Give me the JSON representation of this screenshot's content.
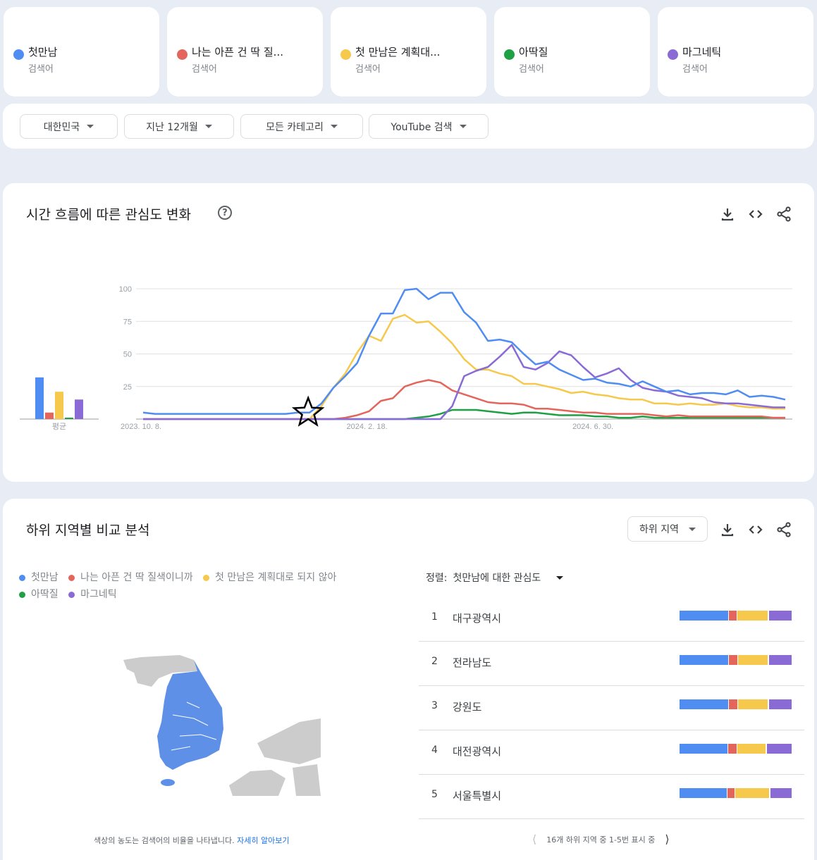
{
  "terms": [
    {
      "name": "첫만남",
      "sub": "검색어",
      "color": "#4f8df2"
    },
    {
      "name": "나는 아픈 건 딱 질...",
      "sub": "검색어",
      "color": "#e4655c"
    },
    {
      "name": "첫 만남은 계획대...",
      "sub": "검색어",
      "color": "#f6c94c"
    },
    {
      "name": "아딱질",
      "sub": "검색어",
      "color": "#1fa045"
    },
    {
      "name": "마그네틱",
      "sub": "검색어",
      "color": "#8a6bd6"
    }
  ],
  "filters": [
    {
      "label": "대한민국"
    },
    {
      "label": "지난 12개월"
    },
    {
      "label": "모든 카테고리"
    },
    {
      "label": "YouTube 검색"
    }
  ],
  "timeline": {
    "title": "시간 흐름에 따른 관심도 변화",
    "help": "?",
    "avg_label": "평균"
  },
  "icons": {
    "download": "download-icon",
    "embed": "embed-code-icon",
    "share": "share-icon"
  },
  "chart_data": {
    "type": "line",
    "title": "시간 흐름에 따른 관심도 변화",
    "ylim": [
      0,
      100
    ],
    "yticks": [
      "100",
      "75",
      "50",
      "25"
    ],
    "xtick_labels": [
      "2023. 10. 8.",
      "2024. 2. 18.",
      "2024. 6. 30."
    ],
    "xtick_index": [
      0,
      19,
      38
    ],
    "annotation": {
      "type": "star",
      "index": 14
    },
    "grid": true,
    "averages": {
      "label": "평균",
      "values": [
        32,
        5,
        21,
        1,
        15
      ]
    },
    "series": [
      {
        "name": "첫만남",
        "color": "#4f8df2",
        "values": [
          5,
          4,
          4,
          4,
          4,
          4,
          4,
          4,
          4,
          4,
          4,
          4,
          4,
          5,
          5,
          12,
          24,
          33,
          43,
          64,
          81,
          81,
          99,
          100,
          92,
          97,
          97,
          82,
          74,
          60,
          61,
          59,
          50,
          42,
          44,
          38,
          34,
          30,
          31,
          28,
          27,
          25,
          29,
          25,
          21,
          22,
          19,
          20,
          20,
          19,
          22,
          17,
          18,
          17,
          15
        ]
      },
      {
        "name": "나는 아픈 건 딱 질색이니까",
        "color": "#e4655c",
        "values": [
          0,
          0,
          0,
          0,
          0,
          0,
          0,
          0,
          0,
          0,
          0,
          0,
          0,
          0,
          0,
          0,
          0,
          1,
          3,
          6,
          14,
          16,
          25,
          28,
          30,
          28,
          22,
          19,
          16,
          13,
          12,
          12,
          11,
          8,
          8,
          7,
          6,
          5,
          5,
          4,
          4,
          4,
          4,
          3,
          2,
          3,
          2,
          2,
          2,
          2,
          2,
          2,
          2,
          1,
          1
        ]
      },
      {
        "name": "첫 만남은 계획대로 되지 않아",
        "color": "#f6c94c",
        "values": [
          0,
          0,
          0,
          0,
          0,
          0,
          0,
          0,
          0,
          0,
          0,
          0,
          0,
          0,
          0,
          10,
          24,
          35,
          51,
          64,
          60,
          77,
          80,
          74,
          75,
          67,
          58,
          46,
          38,
          38,
          35,
          33,
          27,
          27,
          25,
          23,
          20,
          21,
          19,
          18,
          16,
          15,
          15,
          12,
          12,
          11,
          12,
          11,
          11,
          12,
          10,
          9,
          9,
          8,
          8
        ]
      },
      {
        "name": "아딱질",
        "color": "#1fa045",
        "values": [
          0,
          0,
          0,
          0,
          0,
          0,
          0,
          0,
          0,
          0,
          0,
          0,
          0,
          0,
          0,
          0,
          0,
          0,
          0,
          0,
          0,
          0,
          0,
          1,
          2,
          4,
          7,
          7,
          7,
          6,
          5,
          4,
          5,
          5,
          4,
          3,
          3,
          3,
          2,
          2,
          1,
          1,
          2,
          1,
          1,
          1,
          1,
          1,
          1,
          1,
          1,
          1,
          1,
          1,
          1
        ]
      },
      {
        "name": "마그네틱",
        "color": "#8a6bd6",
        "values": [
          0,
          0,
          0,
          0,
          0,
          0,
          0,
          0,
          0,
          0,
          0,
          0,
          0,
          0,
          0,
          0,
          0,
          0,
          0,
          0,
          0,
          0,
          0,
          0,
          0,
          0,
          10,
          33,
          37,
          40,
          48,
          57,
          40,
          38,
          43,
          52,
          49,
          40,
          32,
          35,
          39,
          30,
          24,
          22,
          21,
          18,
          17,
          16,
          13,
          12,
          12,
          11,
          10,
          9,
          9
        ]
      }
    ]
  },
  "regions": {
    "title": "하위 지역별 비교 분석",
    "legend": [
      "첫만남",
      "나는 아픈 건 딱 질색이니까",
      "첫 만남은 계획대로 되지 않아",
      "아딱질",
      "마그네틱"
    ],
    "region_select": "하위 지역",
    "sort_label": "정렬:",
    "sort_value": "첫만남에 대한 관심도",
    "rows": [
      {
        "rank": "1",
        "name": "대구광역시",
        "shares": [
          43,
          7,
          27,
          1,
          20
        ]
      },
      {
        "rank": "2",
        "name": "전라남도",
        "shares": [
          43,
          8,
          26,
          1,
          20
        ]
      },
      {
        "rank": "3",
        "name": "강원도",
        "shares": [
          43,
          8,
          26,
          1,
          20
        ]
      },
      {
        "rank": "4",
        "name": "대전광역시",
        "shares": [
          43,
          8,
          25,
          1,
          22
        ]
      },
      {
        "rank": "5",
        "name": "서울특별시",
        "shares": [
          42,
          7,
          30,
          1,
          19
        ]
      }
    ],
    "pager_text": "16개 하위 지역 중 1-5번 표시 중",
    "map_note": "색상의 농도는 검색어의 비율을 나타냅니다.",
    "map_link": "자세히 알아보기",
    "map_color": "#5e90e8"
  }
}
